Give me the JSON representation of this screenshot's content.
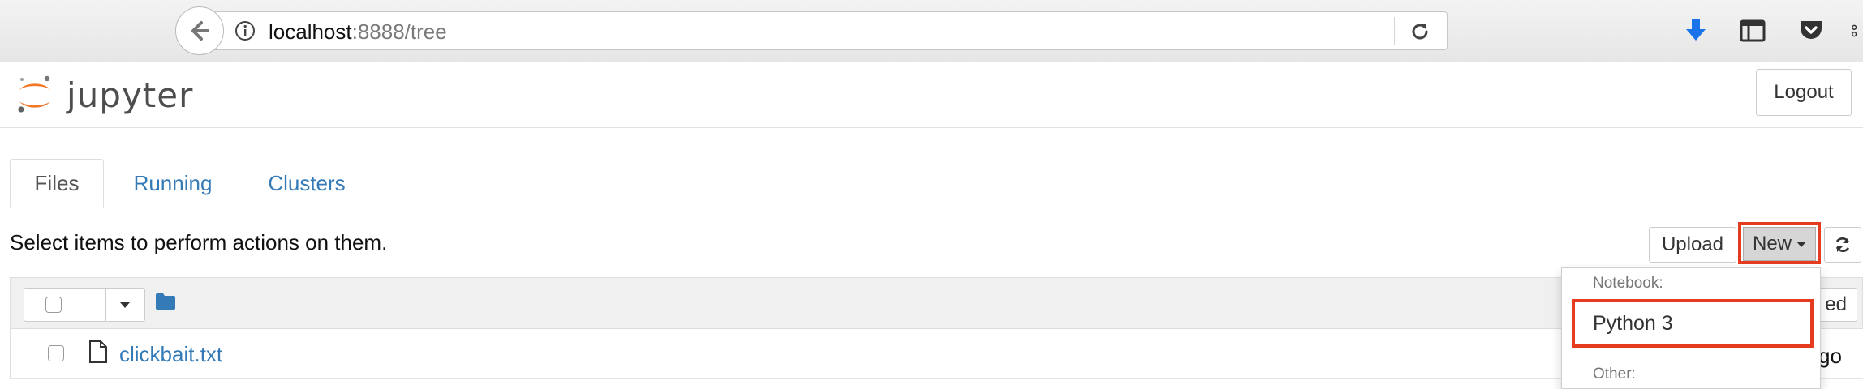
{
  "browser": {
    "url_host": "localhost",
    "url_rest": ":8888/tree"
  },
  "header": {
    "logo_text": "jupyter",
    "logout_label": "Logout"
  },
  "tabs": [
    {
      "label": "Files",
      "active": true
    },
    {
      "label": "Running",
      "active": false
    },
    {
      "label": "Clusters",
      "active": false
    }
  ],
  "toolbar": {
    "hint": "Select items to perform actions on them.",
    "upload_label": "Upload",
    "new_label": "New"
  },
  "list": {
    "header_button_partial": "ed",
    "files": [
      {
        "name": "clickbait.txt",
        "modified_partial": "go"
      }
    ]
  },
  "new_menu": {
    "section_notebook": "Notebook:",
    "python3": "Python 3",
    "section_other": "Other:"
  },
  "colors": {
    "link": "#337ab7",
    "highlight": "#e53c1f",
    "logo_orange": "#f37726",
    "download_blue": "#1a73e8"
  }
}
